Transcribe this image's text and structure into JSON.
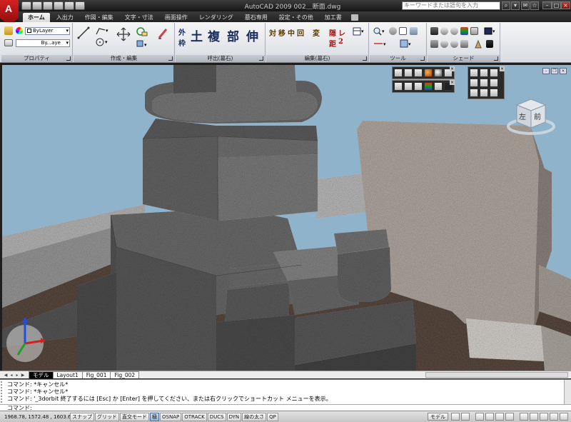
{
  "titlebar": {
    "app_logo_letter": "A",
    "window_title": "AutoCAD 2009 002＿断面.dwg",
    "search_placeholder": "キーワードまたは語句を入力"
  },
  "tabs": [
    "ホーム",
    "入出力",
    "作図・編集",
    "文字・寸法",
    "画面操作",
    "レンダリング",
    "墓石専用",
    "設定・その他",
    "加工書"
  ],
  "ribbon": {
    "properties": {
      "title": "プロパティ",
      "layer_value": "ByLayer",
      "linetype_value": "By...aye"
    },
    "draw_edit": {
      "title": "作成・編集"
    },
    "call": {
      "title": "呼出(墓石)",
      "kanji": [
        "外",
        "枠",
        "土",
        "複",
        "部",
        "伸"
      ]
    },
    "edit_stone": {
      "title": "編集(墓石)",
      "kanji": [
        "対",
        "移",
        "中",
        "回",
        "変",
        "隠",
        "レ",
        "距",
        "2"
      ]
    },
    "tools": {
      "title": "ツール"
    },
    "shade": {
      "title": "シェード"
    }
  },
  "viewcube": {
    "face_left": "左",
    "face_front": "前"
  },
  "layout_tabs": [
    "モデル",
    "Layout1",
    "Fig_001",
    "Fig_002"
  ],
  "command_history": [
    "コマンド: *キャンセル*",
    "コマンド: *キャンセル*",
    "コマンド: '_3dorbit 終了するには [Esc] か [Enter] を押してください、または右クリックでショートカット メニューを表示。"
  ],
  "command_prompt": "コマンド:",
  "statusbar": {
    "coordinates": "1968.78,  1572.48  , 1603.62",
    "toggles": [
      {
        "label": "スナップ",
        "on": false
      },
      {
        "label": "グリッド",
        "on": false
      },
      {
        "label": "直交モード",
        "on": false
      },
      {
        "label": "極",
        "on": true
      },
      {
        "label": "OSNAP",
        "on": false
      },
      {
        "label": "OTRACK",
        "on": false
      },
      {
        "label": "DUCS",
        "on": false
      },
      {
        "label": "DYN",
        "on": false
      },
      {
        "label": "線の太さ",
        "on": false
      },
      {
        "label": "QP",
        "on": false
      }
    ],
    "model_label": "モデル"
  },
  "colors": {
    "ribbon_title_color": "#1a2c60",
    "accent_red": "#d42020",
    "sky": "#8fb3cb"
  }
}
